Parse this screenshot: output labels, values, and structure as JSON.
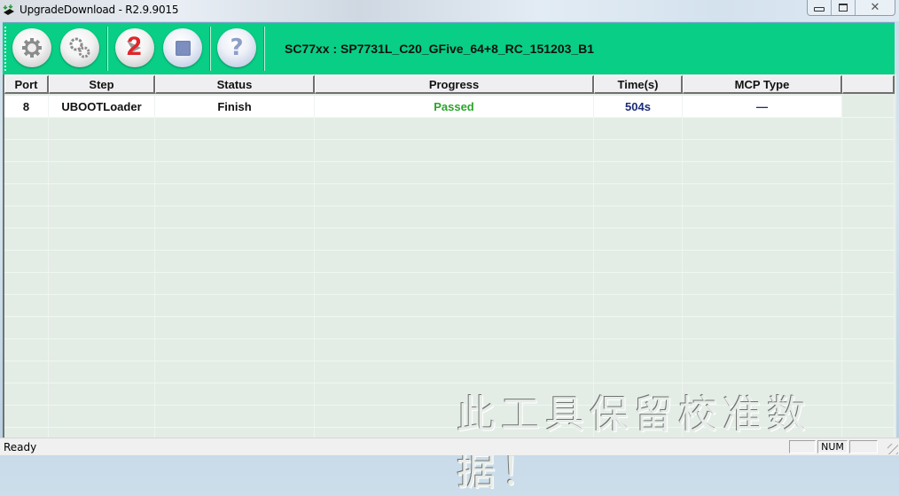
{
  "window": {
    "title": "UpgradeDownload - R2.9.9015",
    "controls": {
      "minimize": "minimize",
      "maximize": "maximize",
      "close": "close"
    }
  },
  "toolbar": {
    "buttons": [
      {
        "name": "settings",
        "icon": "gear-icon"
      },
      {
        "name": "advanced-settings",
        "icon": "gears-icon"
      },
      {
        "name": "start",
        "icon": "start-icon",
        "badge": "2"
      },
      {
        "name": "stop",
        "icon": "stop-icon"
      },
      {
        "name": "help",
        "icon": "help-icon",
        "glyph": "?"
      }
    ],
    "device_label": "SC77xx : SP7731L_C20_GFive_64+8_RC_151203_B1",
    "accent_color": "#08cf85"
  },
  "grid": {
    "columns": [
      "Port",
      "Step",
      "Status",
      "Progress",
      "Time(s)",
      "MCP Type",
      ""
    ],
    "rows": [
      {
        "port": "8",
        "step": "UBOOTLoader",
        "status": "Finish",
        "progress": "Passed",
        "time": "504s",
        "mcp_type": "—"
      }
    ],
    "watermark": "此工具保留校准数据！",
    "colors": {
      "passed": "#2aa52a",
      "time": "#1b2b7a"
    }
  },
  "statusbar": {
    "text": "Ready",
    "panes": [
      "",
      "NUM",
      ""
    ]
  }
}
